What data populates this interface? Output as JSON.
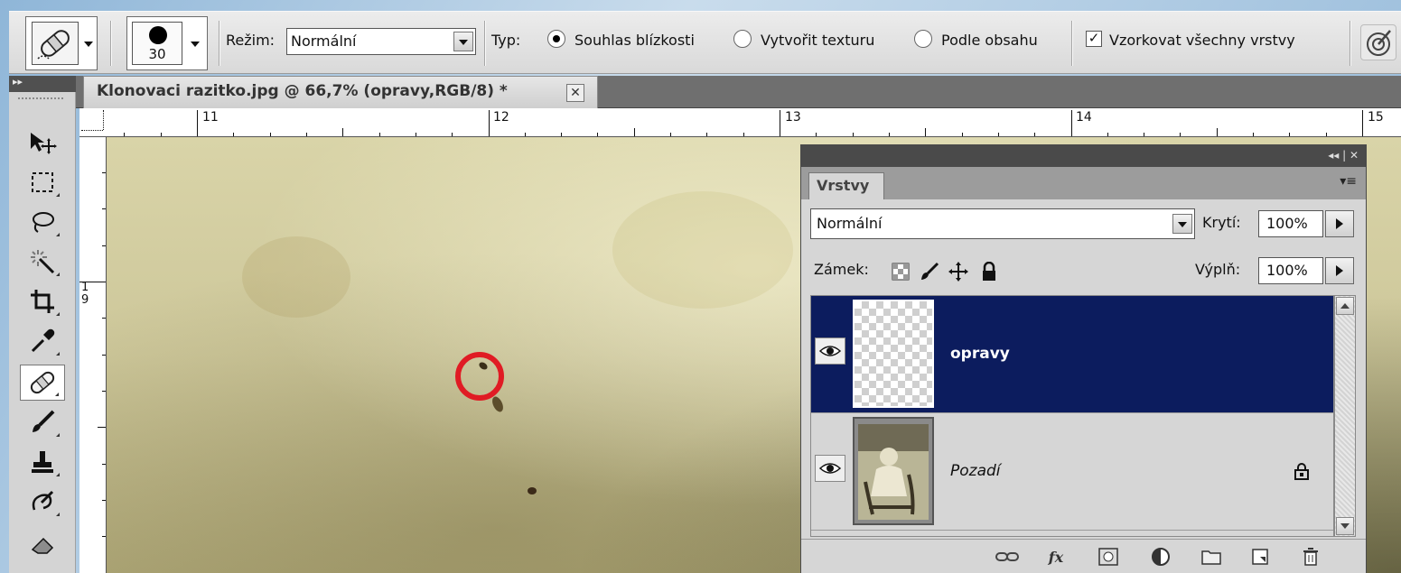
{
  "options_bar": {
    "brush_size": "30",
    "mode_label": "Režim:",
    "mode_value": "Normální",
    "type_label": "Typ:",
    "type_options": [
      "Souhlas blízkosti",
      "Vytvořit texturu",
      "Podle obsahu"
    ],
    "type_selected_index": 0,
    "sample_all_label": "Vzorkovat všechny vrstvy",
    "sample_all_checked": true,
    "checkbox_mark": "✓"
  },
  "document": {
    "tab_title": "Klonovaci razitko.jpg @ 66,7% (opravy,RGB/8) *",
    "close_glyph": "✕"
  },
  "rulers": {
    "horizontal": [
      "11",
      "12",
      "13",
      "14",
      "15"
    ],
    "vertical_digits": [
      "1",
      "9"
    ]
  },
  "panel": {
    "title_controls": "◂◂ | ✕",
    "tab_label": "Vrstvy",
    "menu_glyph": "▾≡",
    "blend_mode": "Normální",
    "opacity_label": "Krytí:",
    "opacity_value": "100%",
    "lock_label": "Zámek:",
    "fill_label": "Výplň:",
    "fill_value": "100%",
    "layers": [
      {
        "name": "opravy",
        "selected": true,
        "visible": true,
        "locked": false,
        "thumb": "transparent"
      },
      {
        "name": "Pozadí",
        "selected": false,
        "visible": true,
        "locked": true,
        "thumb": "photo"
      }
    ],
    "footer_icons": [
      "link-icon",
      "fx-icon",
      "mask-icon",
      "adjustment-icon",
      "group-icon",
      "new-layer-icon",
      "trash-icon"
    ],
    "fx_text": "fx"
  },
  "colors": {
    "selected_layer": "#0c1c5e",
    "marker": "#e01b24",
    "canvas_paper": "#d9d4a8"
  }
}
